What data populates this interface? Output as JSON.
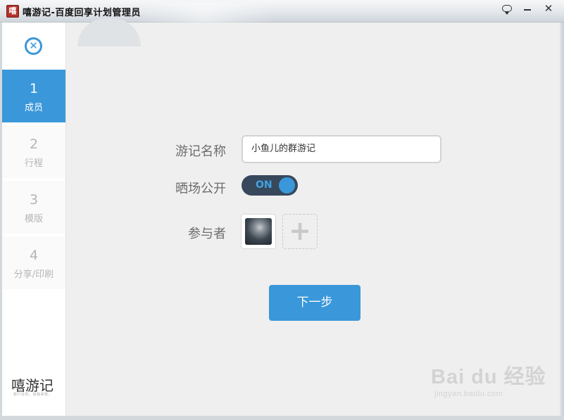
{
  "window": {
    "icon_char": "嘻",
    "title": "嘻游记-百度回享计划管理员"
  },
  "sidebar": {
    "steps": [
      {
        "number": "1",
        "label": "成员",
        "active": true
      },
      {
        "number": "2",
        "label": "行程",
        "active": false
      },
      {
        "number": "3",
        "label": "模版",
        "active": false
      },
      {
        "number": "4",
        "label": "分享/印刷",
        "active": false
      }
    ],
    "brand": "嘻游记",
    "brand_tagline": "旅行在你，由我来管。"
  },
  "form": {
    "name_label": "游记名称",
    "name_value": "小鱼儿的群游记",
    "public_label": "晒场公开",
    "public_toggle": "ON",
    "members_label": "参与者",
    "add_member": "+",
    "next_button": "下一步"
  },
  "watermark": {
    "main": "Bai du 经验",
    "sub": "jingyan.baidu.com"
  },
  "colors": {
    "accent": "#3a97d9",
    "toggle_bg": "#38485c"
  }
}
